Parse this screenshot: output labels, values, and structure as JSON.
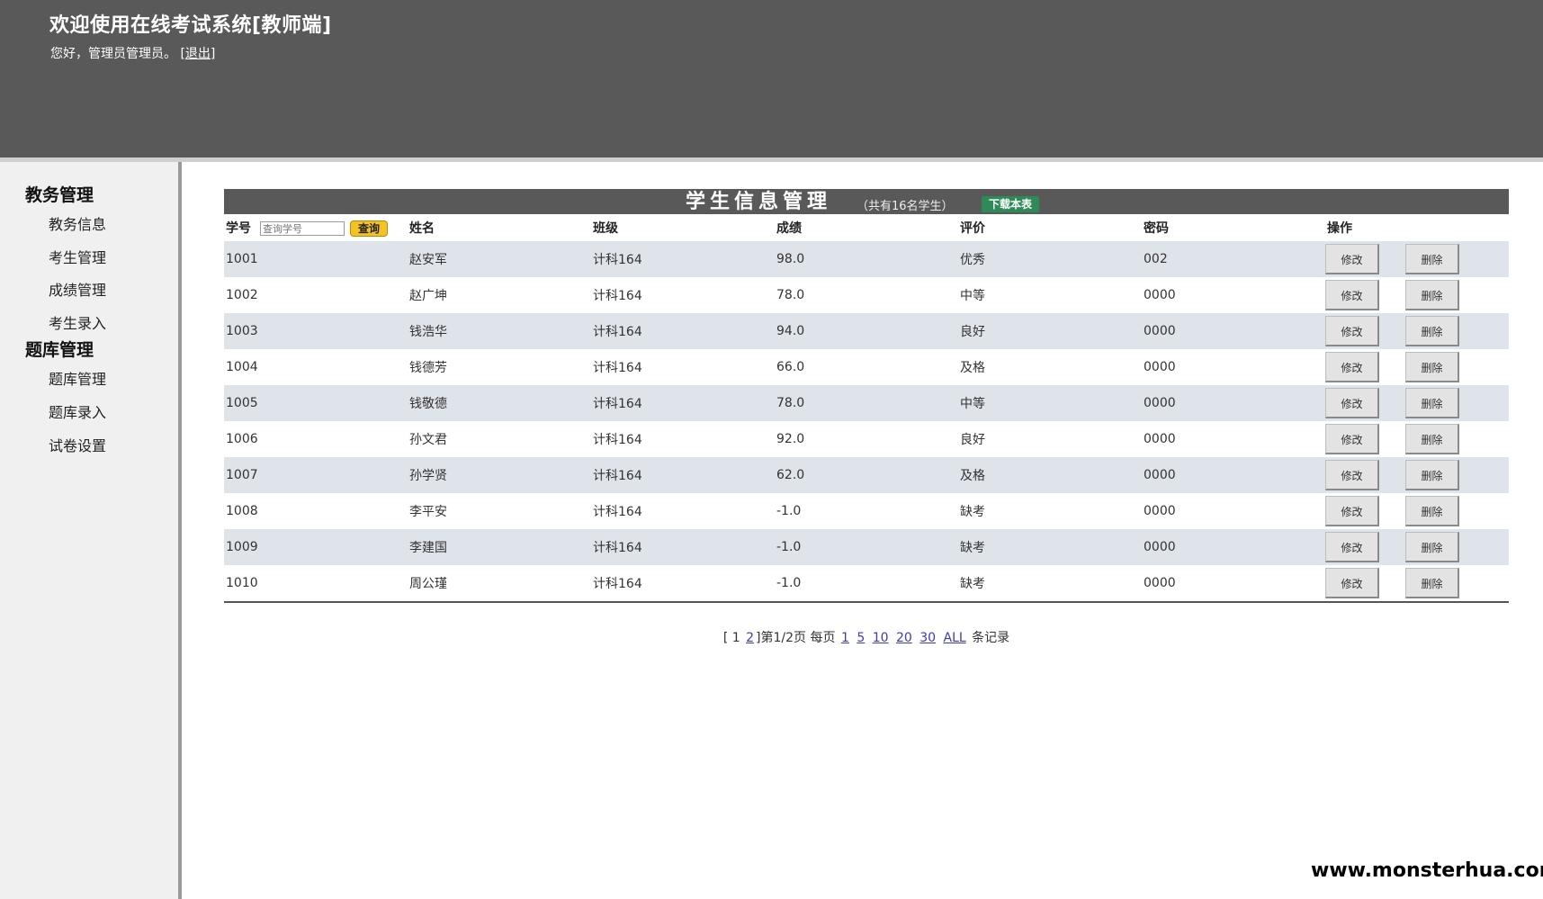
{
  "header": {
    "title": "欢迎使用在线考试系统[教师端]",
    "greeting": "您好，管理员管理员。",
    "logout": "[退出]"
  },
  "sidebar": {
    "sections": [
      {
        "label": "教务管理",
        "items": [
          "教务信息",
          "考生管理",
          "成绩管理",
          "考生录入"
        ]
      },
      {
        "label": "题库管理",
        "items": [
          "题库管理",
          "题库录入",
          "试卷设置"
        ]
      }
    ]
  },
  "main": {
    "title": "学生信息管理",
    "count_text": "（共有16名学生）",
    "download_label": "下载本表",
    "search_placeholder": "查询学号",
    "search_button": "查询",
    "columns": [
      "学号",
      "姓名",
      "班级",
      "成绩",
      "评价",
      "密码",
      "操作"
    ],
    "edit_label": "修改",
    "delete_label": "删除",
    "rows": [
      [
        "1001",
        "赵安军",
        "计科164",
        "98.0",
        "优秀",
        "002"
      ],
      [
        "1002",
        "赵广坤",
        "计科164",
        "78.0",
        "中等",
        "0000"
      ],
      [
        "1003",
        "钱浩华",
        "计科164",
        "94.0",
        "良好",
        "0000"
      ],
      [
        "1004",
        "钱德芳",
        "计科164",
        "66.0",
        "及格",
        "0000"
      ],
      [
        "1005",
        "钱敬德",
        "计科164",
        "78.0",
        "中等",
        "0000"
      ],
      [
        "1006",
        "孙文君",
        "计科164",
        "92.0",
        "良好",
        "0000"
      ],
      [
        "1007",
        "孙学贤",
        "计科164",
        "62.0",
        "及格",
        "0000"
      ],
      [
        "1008",
        "李平安",
        "计科164",
        "-1.0",
        "缺考",
        "0000"
      ],
      [
        "1009",
        "李建国",
        "计科164",
        "-1.0",
        "缺考",
        "0000"
      ],
      [
        "1010",
        "周公瑾",
        "计科164",
        "-1.0",
        "缺考",
        "0000"
      ]
    ]
  },
  "pager": {
    "open": "[",
    "current": "1",
    "page2": "2",
    "close": "]",
    "page_info": "第1/2页",
    "per_page_label": "每页",
    "sizes": [
      "1",
      "5",
      "10",
      "20",
      "30",
      "ALL"
    ],
    "suffix": "条记录"
  },
  "watermark": "www.monsterhua.com"
}
